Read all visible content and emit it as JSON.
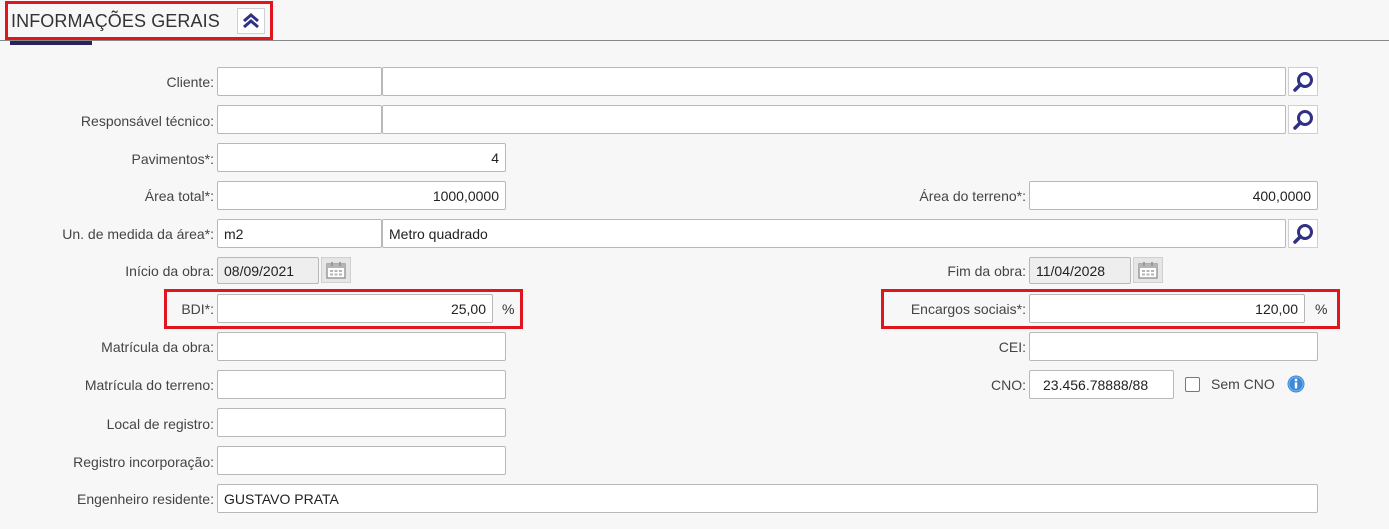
{
  "section": {
    "title": "INFORMAÇÕES GERAIS",
    "collapse_icon": "double-chevron-up-icon"
  },
  "colors": {
    "accent": "#25245f",
    "highlight": "#e0151e",
    "icon_blue": "#2e3184",
    "info_blue": "#3a8ad8"
  },
  "form": {
    "cliente": {
      "label": "Cliente:",
      "code": "",
      "name": ""
    },
    "responsavel_tecnico": {
      "label": "Responsável técnico:",
      "code": "",
      "name": ""
    },
    "pavimentos": {
      "label": "Pavimentos*:",
      "value": "4"
    },
    "area_total": {
      "label": "Área total*:",
      "value": "1000,0000"
    },
    "area_terreno": {
      "label": "Área do terreno*:",
      "value": "400,0000"
    },
    "unidade_medida": {
      "label": "Un. de medida da área*:",
      "code": "m2",
      "name": "Metro quadrado"
    },
    "inicio_obra": {
      "label": "Início da obra:",
      "value": "08/09/2021"
    },
    "fim_obra": {
      "label": "Fim da obra:",
      "value": "11/04/2028"
    },
    "bdi": {
      "label": "BDI*:",
      "value": "25,00",
      "unit": "%"
    },
    "encargos_sociais": {
      "label": "Encargos sociais*:",
      "value": "120,00",
      "unit": "%"
    },
    "matricula_obra": {
      "label": "Matrícula da obra:",
      "value": ""
    },
    "cei": {
      "label": "CEI:",
      "value": ""
    },
    "matricula_terreno": {
      "label": "Matrícula do terreno:",
      "value": ""
    },
    "cno": {
      "label": "CNO:",
      "value": "23.456.78888/88",
      "sem_cno_label": "Sem CNO",
      "sem_cno_checked": false
    },
    "local_registro": {
      "label": "Local de registro:",
      "value": ""
    },
    "registro_incorporacao": {
      "label": "Registro incorporação:",
      "value": ""
    },
    "engenheiro_residente": {
      "label": "Engenheiro residente:",
      "value": "GUSTAVO PRATA"
    }
  }
}
